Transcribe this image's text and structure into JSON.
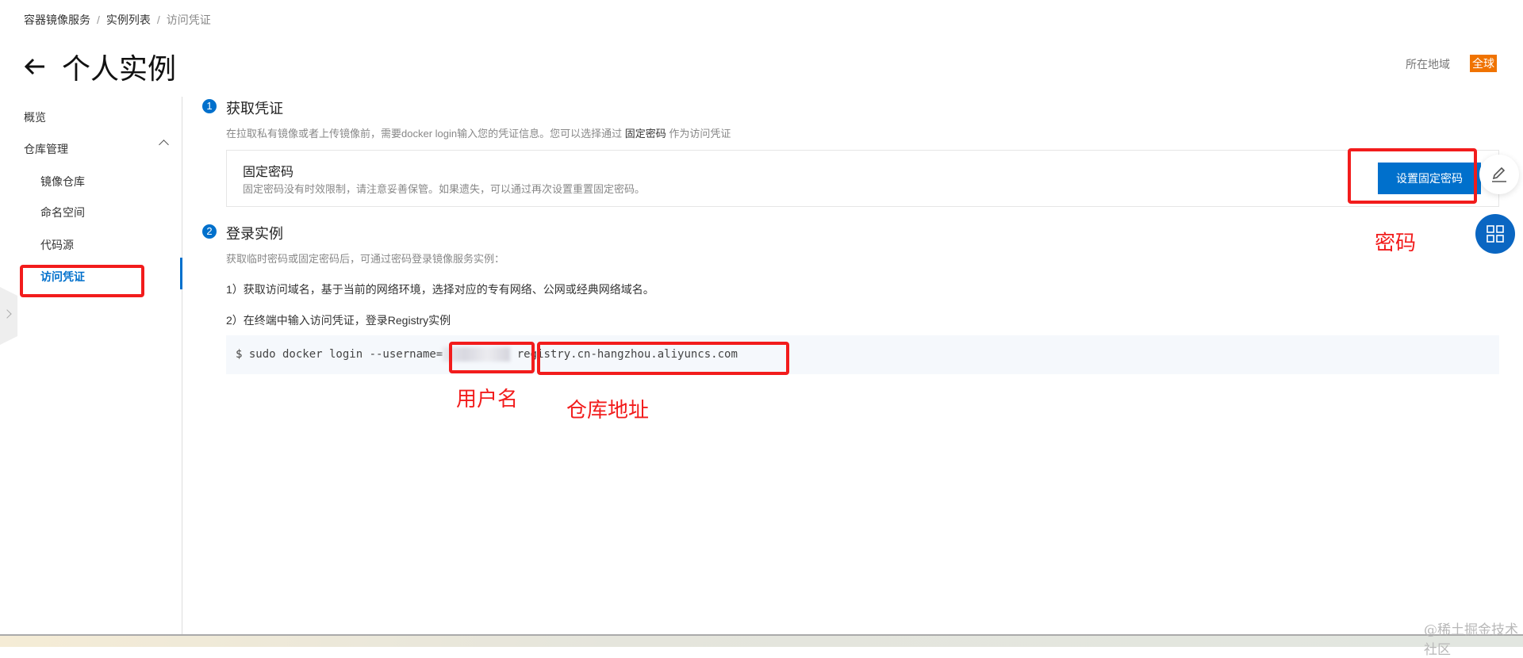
{
  "breadcrumb": [
    "容器镜像服务",
    "实例列表",
    "访问凭证"
  ],
  "title": "个人实例",
  "region": {
    "label": "所在地域",
    "value": "全球"
  },
  "sidebar": {
    "overview": "概览",
    "repo_mgmt": "仓库管理",
    "items": [
      "镜像仓库",
      "命名空间",
      "代码源",
      "访问凭证"
    ]
  },
  "step1": {
    "num": "1",
    "title": "获取凭证",
    "desc_pre": "在拉取私有镜像或者上传镜像前，需要docker login输入您的凭证信息。您可以选择通过 ",
    "desc_link": "固定密码",
    "desc_post": " 作为访问凭证",
    "card_title": "固定密码",
    "card_desc": "固定密码没有时效限制，请注意妥善保管。如果遗失，可以通过再次设置重置固定密码。",
    "button": "设置固定密码"
  },
  "step2": {
    "num": "2",
    "title": "登录实例",
    "desc": "获取临时密码或固定密码后，可通过密码登录镜像服务实例：",
    "item1": "1）获取访问域名，基于当前的网络环境，选择对应的专有网络、公网或经典网络域名。",
    "item2": "2）在终端中输入访问凭证，登录Registry实例",
    "code_pre": "$ sudo docker login --username=",
    "code_host": "registry.cn-hangzhou.aliyuncs.com"
  },
  "annotations": {
    "password": "密码",
    "username": "用户名",
    "repo_address": "仓库地址"
  },
  "watermark": "@稀土掘金技术社区",
  "colors": {
    "accent": "#0070cc",
    "annotation": "#f21c1c",
    "badge": "#f07300"
  }
}
